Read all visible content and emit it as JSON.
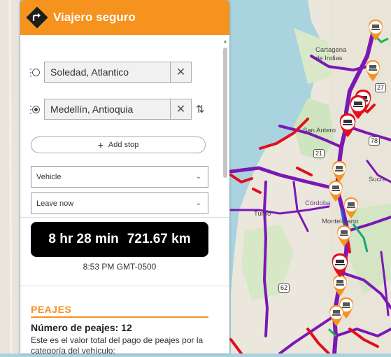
{
  "app": {
    "title": "Viajero seguro"
  },
  "route": {
    "origin": "Soledad, Atlantico",
    "destination": "Medellín, Antioquia",
    "add_stop_label": "Add stop"
  },
  "options": {
    "vehicle": "Vehicle",
    "departure": "Leave now"
  },
  "summary": {
    "duration": "8 hr 28 min",
    "distance": "721.67 km",
    "arrival_time": "8:53 PM GMT-0500"
  },
  "peajes": {
    "heading": "PEAJES",
    "count_text": "Número de peajes: 12",
    "description": "Este es el valor total del pago de peajes por la categoría del vehículo:"
  },
  "map": {
    "labels": [
      "Cartagena de Indias",
      "San Antero",
      "Córdoba",
      "Montelíbano",
      "Sucre",
      "Turbo"
    ],
    "road_numbers": [
      "27",
      "78",
      "21",
      "62"
    ]
  },
  "colors": {
    "accent": "#f6921e",
    "route": "#7b18b5",
    "congestion": "#e0101c",
    "toll_marker": "#f6921e",
    "alert_marker": "#e0101c"
  }
}
